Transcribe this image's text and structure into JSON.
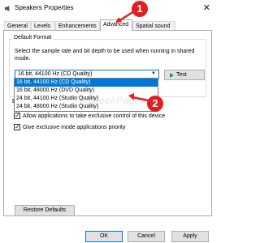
{
  "window": {
    "title": "Speakers Properties",
    "close_label": "✕"
  },
  "tabs": [
    {
      "label": "General"
    },
    {
      "label": "Levels"
    },
    {
      "label": "Enhancements"
    },
    {
      "label": "Advanced"
    },
    {
      "label": "Spatial sound"
    }
  ],
  "default_format": {
    "group_label": "Default Format",
    "description": "Select the sample rate and bit depth to be used when running in shared mode.",
    "selected": "16 bit, 44100 Hz (CD Quality)",
    "test_label": "Test",
    "options": [
      "16 bit, 44100 Hz (CD Quality)",
      "16 bit, 48000 Hz (DVD Quality)",
      "24 bit, 44100 Hz (Studio Quality)",
      "24 bit, 48000 Hz (Studio Quality)"
    ]
  },
  "exclusive": {
    "label": "E",
    "allow_label": "Allow applications to take exclusive control of this device",
    "priority_label": "Give exclusive mode applications priority"
  },
  "buttons": {
    "restore": "Restore Defaults",
    "ok": "OK",
    "cancel": "Cancel",
    "apply": "Apply"
  },
  "annotations": {
    "step1": "1",
    "step2": "2",
    "watermark": "TheGeekPage.com"
  },
  "colors": {
    "accent": "#0078d7",
    "annotation_red": "#e02020",
    "play_green": "#1e9e3e"
  }
}
